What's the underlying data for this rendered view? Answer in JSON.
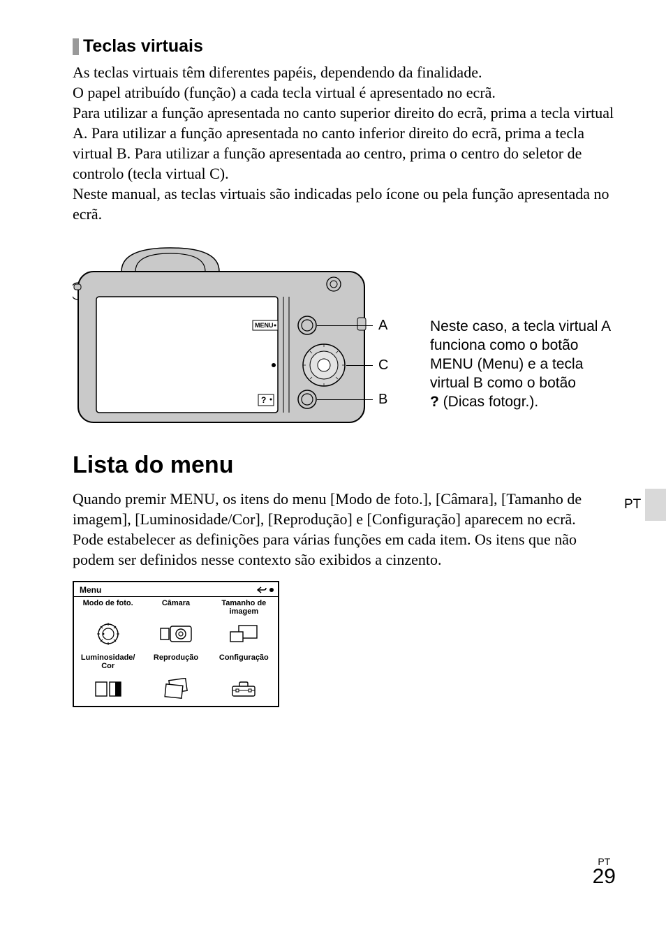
{
  "section_sub_heading": "Teclas virtuais",
  "intro_paragraph": "As teclas virtuais têm diferentes papéis, dependendo da finalidade.\nO papel atribuído (função) a cada tecla virtual é apresentado no ecrã.\nPara utilizar a função apresentada no canto superior direito do ecrã, prima a tecla virtual A. Para utilizar a função apresentada no canto inferior direito do ecrã, prima a tecla virtual B. Para utilizar a função apresentada ao centro, prima o centro do seletor de controlo (tecla virtual C).\nNeste manual, as teclas virtuais são indicadas pelo ícone ou pela função apresentada no ecrã.",
  "diagram": {
    "menu_label": "MENU",
    "question_label": "?",
    "labels": {
      "a": "A",
      "b": "B",
      "c": "C"
    },
    "side_note_before_q": "Neste caso, a tecla virtual A funciona como o botão MENU (Menu) e a tecla virtual B como o botão",
    "side_note_q": "?",
    "side_note_after_q": " (Dicas fotogr.)."
  },
  "menu_heading": "Lista do menu",
  "menu_paragraph": "Quando premir MENU, os itens do menu [Modo de foto.], [Câmara], [Tamanho de imagem], [Luminosidade/Cor], [Reprodução] e [Configuração] aparecem no ecrã.\nPode estabelecer as definições para várias funções em cada item. Os itens que não podem ser definidos nesse contexto são exibidos a cinzento.",
  "lang_tab": "PT",
  "menu_box": {
    "title": "Menu",
    "items": [
      {
        "label": "Modo de foto."
      },
      {
        "label": "Câmara"
      },
      {
        "label": "Tamanho de imagem"
      },
      {
        "label": "Luminosidade/ Cor"
      },
      {
        "label": "Reprodução"
      },
      {
        "label": "Configuração"
      }
    ]
  },
  "footer": {
    "lang": "PT",
    "page": "29"
  }
}
